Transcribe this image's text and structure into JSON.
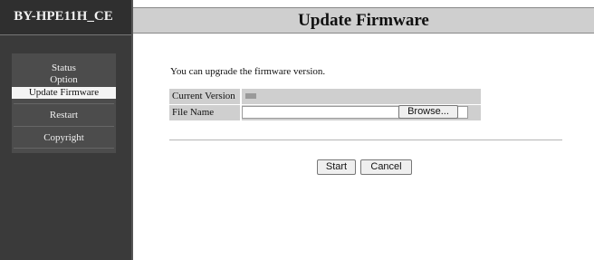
{
  "sidebar": {
    "brand": "BY-HPE11H_CE",
    "items": [
      {
        "label": "Status"
      },
      {
        "label": "Option"
      },
      {
        "label": "Update Firmware"
      },
      {
        "label": "Restart"
      },
      {
        "label": "Copyright"
      }
    ]
  },
  "header": {
    "title": "Update Firmware"
  },
  "form": {
    "intro": "You can upgrade the firmware version.",
    "current_version_label": "Current Version",
    "file_name_label": "File Name",
    "browse_label": "Browse...",
    "start_label": "Start",
    "cancel_label": "Cancel"
  },
  "colors": {
    "sidebar": "#3a3a3a",
    "header": "#cfcfcf",
    "active_item": "#f4f4f4"
  }
}
